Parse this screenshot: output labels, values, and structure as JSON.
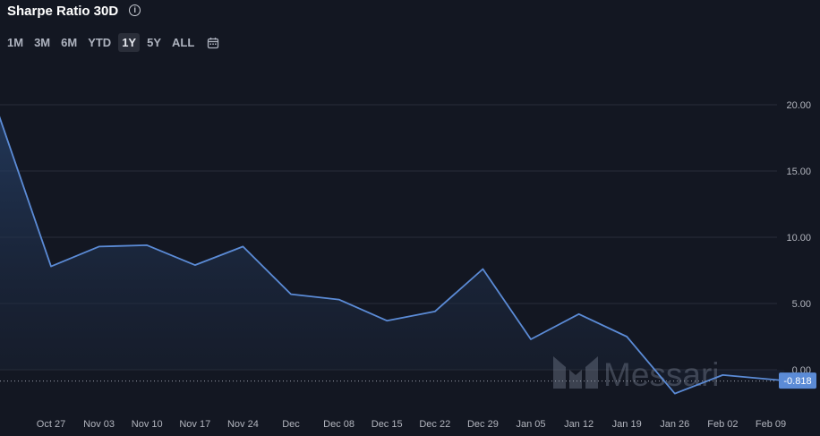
{
  "header": {
    "title": "Sharpe Ratio 30D",
    "info_icon": "info-circle-icon"
  },
  "range_selector": {
    "options": [
      "1M",
      "3M",
      "6M",
      "YTD",
      "1Y",
      "5Y",
      "ALL"
    ],
    "selected": "1Y",
    "calendar_icon": "calendar-icon"
  },
  "watermark": "Messari",
  "colors": {
    "background": "#131722",
    "line": "#5b8bd6",
    "area_top": "#223755",
    "grid": "#2a2e39",
    "axis_text": "#b2b5be",
    "last_value_badge": "#5b8bd6"
  },
  "chart_data": {
    "type": "area",
    "title": "Sharpe Ratio 30D",
    "xlabel": "",
    "ylabel": "",
    "ylim": [
      -3,
      22
    ],
    "y_ticks": [
      0,
      5,
      10,
      15,
      20
    ],
    "y_tick_labels": [
      "0.00",
      "5.00",
      "10.00",
      "15.00",
      "20.00"
    ],
    "x_tick_labels": [
      "Oct 27",
      "Nov 03",
      "Nov 10",
      "Nov 17",
      "Nov 24",
      "Dec",
      "Dec 08",
      "Dec 15",
      "Dec 22",
      "Dec 29",
      "Jan 05",
      "Jan 12",
      "Jan 19",
      "Jan 26",
      "Feb 02",
      "Feb 09"
    ],
    "x_tick_dates": [
      "2024-10-27",
      "2024-11-03",
      "2024-11-10",
      "2024-11-17",
      "2024-11-24",
      "2024-12-01",
      "2024-12-08",
      "2024-12-15",
      "2024-12-22",
      "2024-12-29",
      "2025-01-05",
      "2025-01-12",
      "2025-01-19",
      "2025-01-26",
      "2025-02-02",
      "2025-02-09"
    ],
    "grid": true,
    "legend": "none",
    "last_value_label": "-0.818",
    "series": [
      {
        "points": [
          {
            "x": "2024-10-18",
            "y": 21.3
          },
          {
            "x": "2024-10-27",
            "y": 7.8
          },
          {
            "x": "2024-11-03",
            "y": 9.3
          },
          {
            "x": "2024-11-10",
            "y": 9.4
          },
          {
            "x": "2024-11-17",
            "y": 7.9
          },
          {
            "x": "2024-11-24",
            "y": 9.3
          },
          {
            "x": "2024-12-01",
            "y": 5.7
          },
          {
            "x": "2024-12-08",
            "y": 5.3
          },
          {
            "x": "2024-12-15",
            "y": 3.7
          },
          {
            "x": "2024-12-22",
            "y": 4.4
          },
          {
            "x": "2024-12-29",
            "y": 7.6
          },
          {
            "x": "2025-01-05",
            "y": 2.3
          },
          {
            "x": "2025-01-12",
            "y": 4.2
          },
          {
            "x": "2025-01-19",
            "y": 2.5
          },
          {
            "x": "2025-01-26",
            "y": -1.8
          },
          {
            "x": "2025-02-02",
            "y": -0.4
          },
          {
            "x": "2025-02-11",
            "y": -0.818
          }
        ]
      }
    ]
  }
}
